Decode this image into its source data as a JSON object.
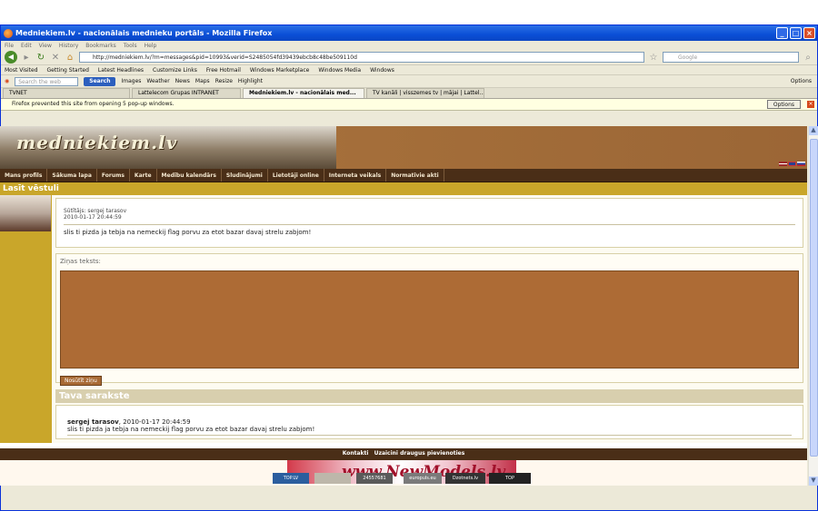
{
  "window": {
    "title": "Medniekiem.lv - nacionālais mednieku portāls - Mozilla Firefox"
  },
  "menu": [
    "File",
    "Edit",
    "View",
    "History",
    "Bookmarks",
    "Tools",
    "Help"
  ],
  "navbar": {
    "url": "http://medniekiem.lv/?m=messages&pid=10993&verid=S2485054fd39439ebcb8c48be509110d",
    "search_placeholder": "Google"
  },
  "bookmarks": [
    "Most Visited",
    "Getting Started",
    "Latest Headlines",
    "Customize Links",
    "Free Hotmail",
    "Windows Marketplace",
    "Windows Media",
    "Windows"
  ],
  "toolbar2": {
    "search_placeholder": "Search the web",
    "search_label": "Search",
    "items": [
      "Images",
      "Weather",
      "News",
      "Maps",
      "Resize",
      "Highlight"
    ],
    "options": "Options"
  },
  "tabs": [
    {
      "label": "TVNET",
      "active": false
    },
    {
      "label": "Lattelecom Grupas INTRANET",
      "active": false
    },
    {
      "label": "Medniekiem.lv - nacionālais med...",
      "active": true
    },
    {
      "label": "TV kanāli | visszemes tv | mājai | Lattel...",
      "active": false
    }
  ],
  "popup": {
    "text": "Firefox prevented this site from opening 5 pop-up windows.",
    "options": "Options"
  },
  "site": {
    "logo": "medniekiem.lv",
    "nav": [
      "Mans profils",
      "Sākuma lapa",
      "Forums",
      "Karte",
      "Medību kalendārs",
      "Sludinājumi",
      "Lietotāji online",
      "Interneta veikals",
      "Normatīvie akti"
    ],
    "section_title": "Lasīt vēstuli",
    "message": {
      "sender": "Sūtītājs: sergej tarasov",
      "date": "2010-01-17 20:44:59",
      "text": "slis ti pizda ja tebja na nemeckij flag porvu za etot bazar davaj strelu zabjom!"
    },
    "reply": {
      "label": "Ziņas teksts:",
      "send": "Nosūtīt ziņu"
    },
    "thread_title": "Tava sarakste",
    "thread": {
      "author": "sergej tarasov",
      "date": ", 2010-01-17 20:44:59",
      "text": "slis ti pizda ja tebja na nemeckij flag porvu za etot bazar davaj strelu zabjom!"
    },
    "footer": [
      "Kontakti",
      "Uzaicini draugus pievienoties"
    ],
    "ad": {
      "text": "www.NewModels.lv",
      "badges": [
        "TOP.LV",
        "",
        "24557681",
        "europuls.eu",
        "Dzotnets.lv",
        "TOP"
      ]
    }
  }
}
